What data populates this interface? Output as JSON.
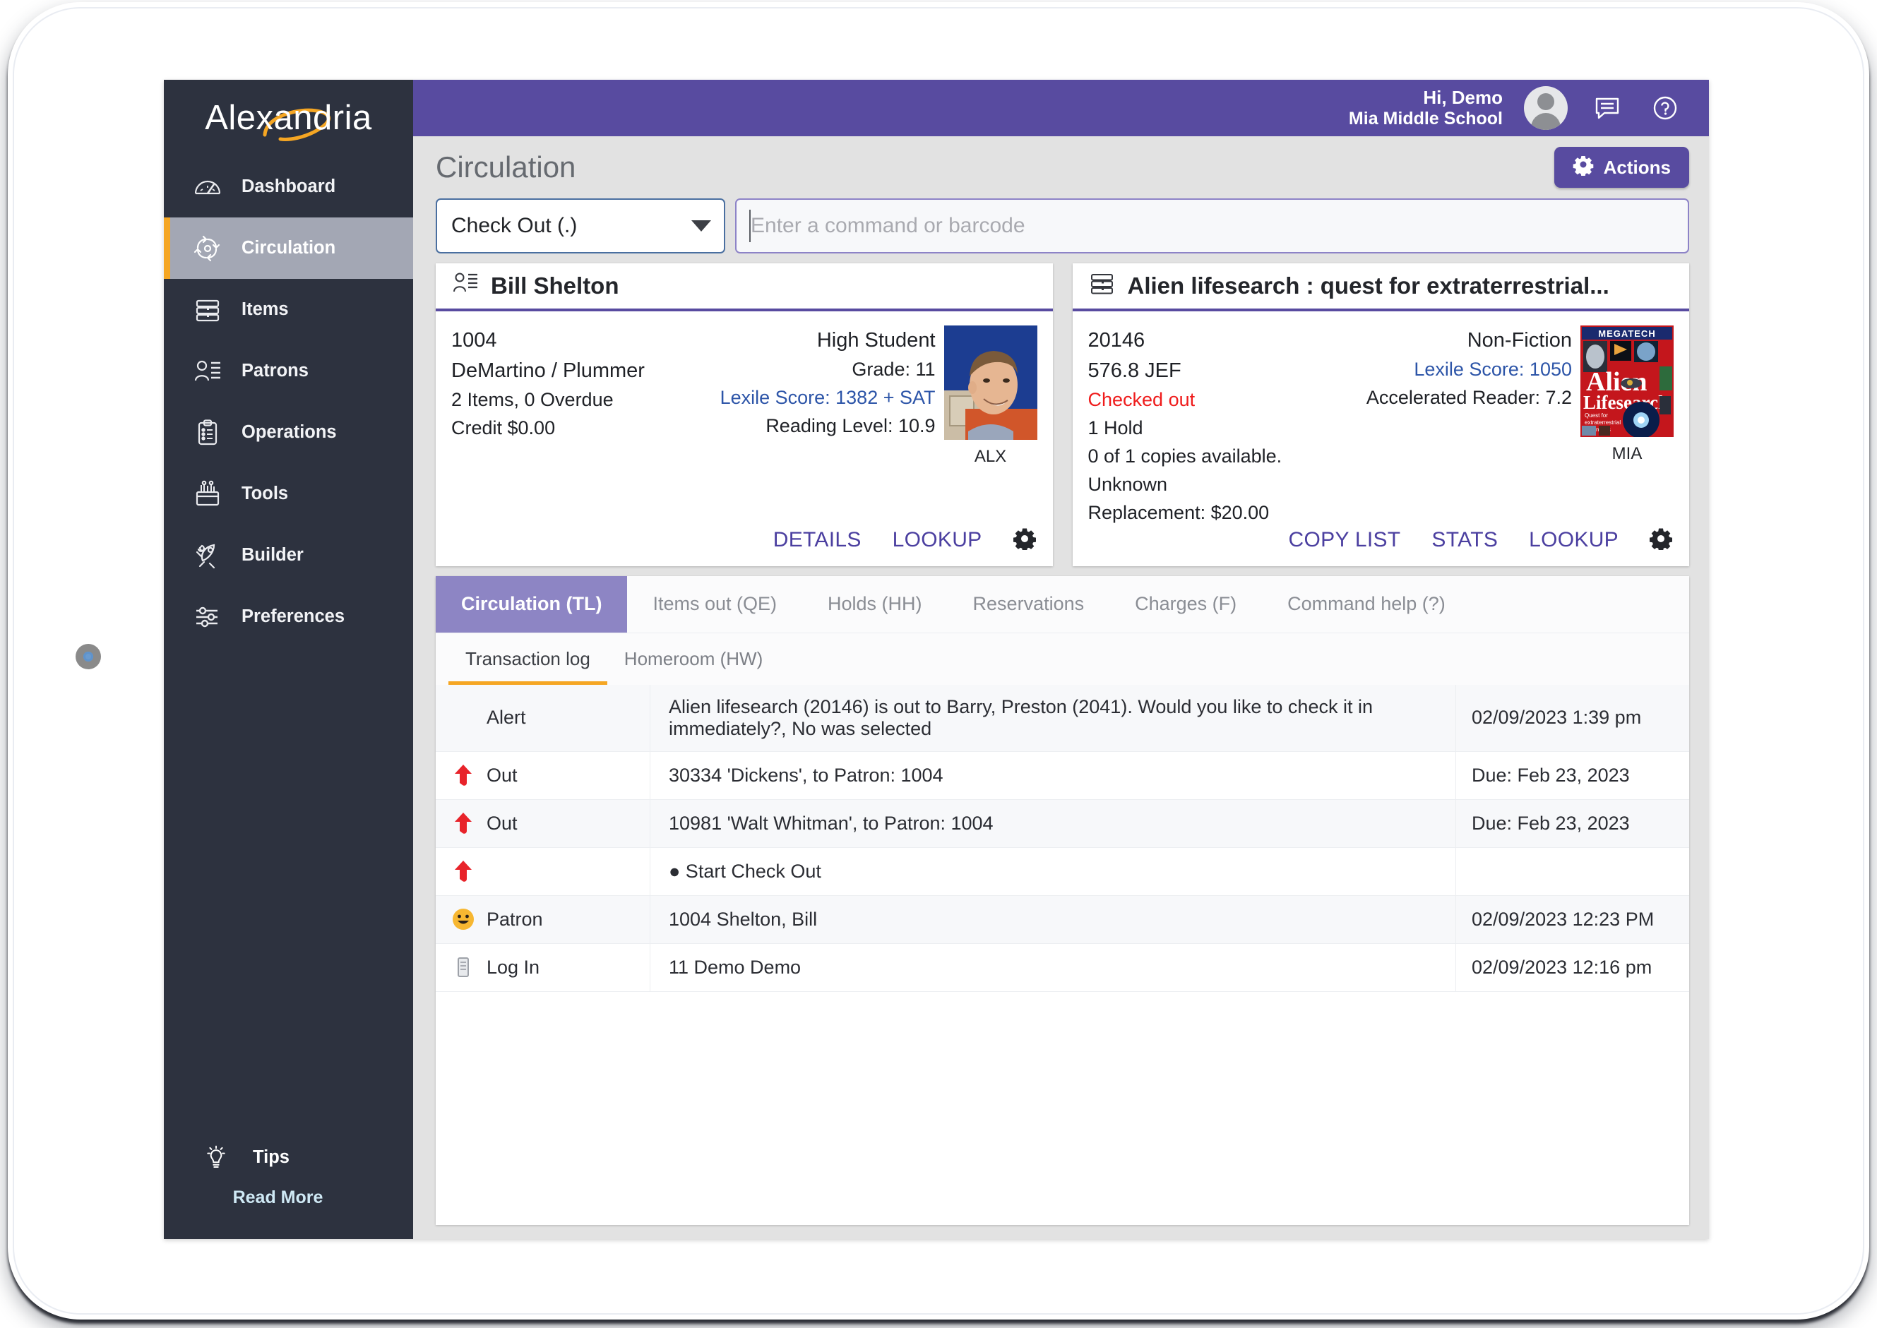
{
  "app": {
    "logo": "Alexandria",
    "logo_accent_color": "#f5a623"
  },
  "sidebar": {
    "items": [
      {
        "label": "Dashboard",
        "icon": "gauge-icon",
        "active": false
      },
      {
        "label": "Circulation",
        "icon": "circulation-icon",
        "active": true
      },
      {
        "label": "Items",
        "icon": "books-icon",
        "active": false
      },
      {
        "label": "Patrons",
        "icon": "patron-icon",
        "active": false
      },
      {
        "label": "Operations",
        "icon": "clipboard-icon",
        "active": false
      },
      {
        "label": "Tools",
        "icon": "toolbox-icon",
        "active": false
      },
      {
        "label": "Builder",
        "icon": "rocket-wrench-icon",
        "active": false
      },
      {
        "label": "Preferences",
        "icon": "sliders-icon",
        "active": false
      }
    ],
    "tips_label": "Tips",
    "tips_icon": "lightbulb-icon",
    "read_more_label": "Read More"
  },
  "header": {
    "greeting": "Hi, Demo",
    "school": "Mia Middle School",
    "avatar_icon": "user-avatar",
    "message_icon": "message-icon",
    "help_icon": "help-icon",
    "accent_color": "#584ba0"
  },
  "page": {
    "title": "Circulation",
    "actions_label": "Actions",
    "actions_icon": "gear-caret-icon"
  },
  "command": {
    "mode_value": "Check Out (.)",
    "input_placeholder": "Enter a command or barcode",
    "input_value": ""
  },
  "patron_card": {
    "icon": "patron-icon",
    "title": "Bill Shelton",
    "barcode": "1004",
    "homeroom": "DeMartino / Plummer",
    "items_line": "2 Items, 0 Overdue",
    "credit": "Credit $0.00",
    "policy": "High Student",
    "grade": "Grade: 11",
    "lexile": "Lexile Score: 1382 + SAT",
    "reading_level": "Reading Level: 10.9",
    "site_code": "ALX",
    "links": [
      "DETAILS",
      "LOOKUP"
    ],
    "gear_icon": "gear-icon"
  },
  "item_card": {
    "icon": "books-icon",
    "title": "Alien lifesearch : quest for extraterrestrial...",
    "barcode": "20146",
    "call_number": "576.8 JEF",
    "status": "Checked out",
    "holds": "1 Hold",
    "copies": "0 of 1 copies available.",
    "location": "Unknown",
    "replacement": "Replacement: $20.00",
    "policy": "Non-Fiction",
    "lexile": "Lexile Score: 1050",
    "accelerated_reader": "Accelerated Reader: 7.2",
    "site_code": "MIA",
    "cover_publisher": "MEGATECH",
    "cover_title_1": "Alien",
    "cover_title_2": "Lifesearch",
    "cover_subtitle": "Quest for extraterrestrial organisms",
    "links": [
      "COPY LIST",
      "STATS",
      "LOOKUP"
    ],
    "gear_icon": "gear-icon"
  },
  "tabs": [
    {
      "label": "Circulation (TL)",
      "active": true
    },
    {
      "label": "Items out (QE)",
      "active": false
    },
    {
      "label": "Holds (HH)",
      "active": false
    },
    {
      "label": "Reservations",
      "active": false
    },
    {
      "label": "Charges (F)",
      "active": false
    },
    {
      "label": "Command help (?)",
      "active": false
    }
  ],
  "subtabs": [
    {
      "label": "Transaction log",
      "active": true
    },
    {
      "label": "Homeroom (HW)",
      "active": false
    }
  ],
  "log_rows": [
    {
      "icon": "",
      "type": "Alert",
      "description": "Alien lifesearch (20146) is out to Barry, Preston (2041). Would you like to check it in immediately?, No was selected",
      "time": "02/09/2023 1:39 pm"
    },
    {
      "icon": "red-up-arrow-icon",
      "type": "Out",
      "description": "30334 'Dickens', to Patron: 1004",
      "time": "Due: Feb 23, 2023"
    },
    {
      "icon": "red-up-arrow-icon",
      "type": "Out",
      "description": "10981 'Walt Whitman', to Patron: 1004",
      "time": "Due: Feb 23, 2023"
    },
    {
      "icon": "red-up-arrow-icon",
      "type": "",
      "description": "● Start Check Out",
      "time": ""
    },
    {
      "icon": "smiley-icon",
      "type": "Patron",
      "description": "1004 Shelton, Bill",
      "time": "02/09/2023 12:23 PM"
    },
    {
      "icon": "login-icon",
      "type": "Log In",
      "description": "11 Demo Demo",
      "time": "02/09/2023 12:16 pm"
    }
  ]
}
